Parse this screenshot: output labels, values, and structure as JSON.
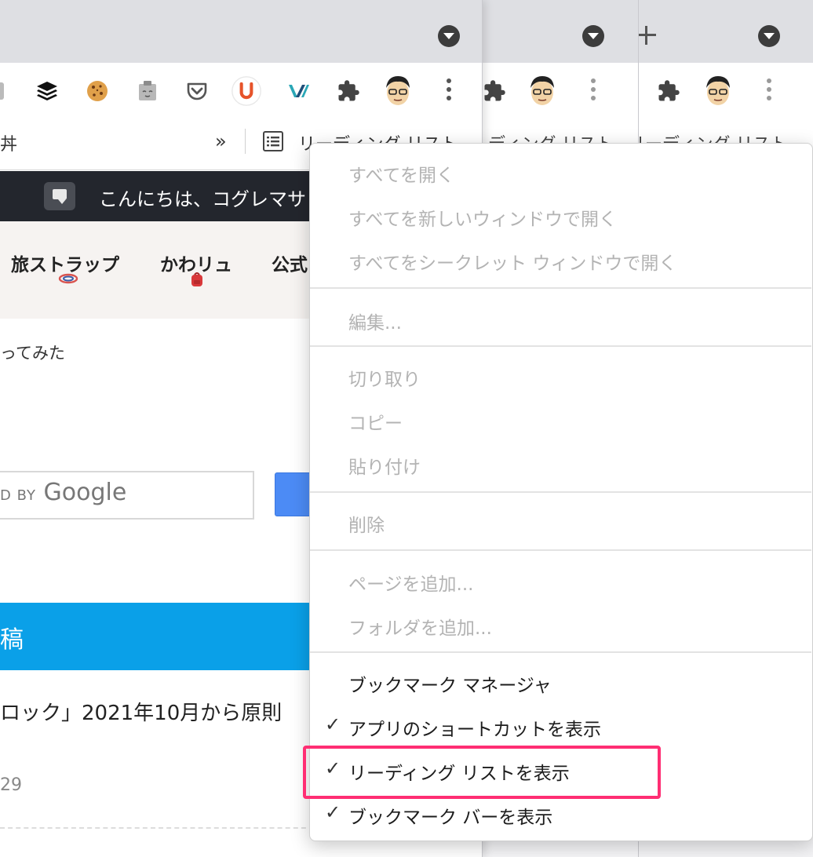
{
  "browser": {
    "bookmarks_bar": {
      "left_fragment": "丼",
      "overflow_chevron": "»",
      "reading_list_label": "リーディング リスト",
      "reading_list_label_w2": "ディング リスト",
      "reading_list_label_w3": "リーディング リスト"
    },
    "icons": [
      "menu-dropdown-icon",
      "new-tab-icon",
      "buffer-stack-icon",
      "cookie-icon",
      "clipboard-extension-icon",
      "pocket-icon",
      "u-extension-icon",
      "v-extension-icon",
      "puzzle-extensions-icon",
      "profile-avatar-icon",
      "kebab-menu-icon",
      "reading-list-icon"
    ]
  },
  "page": {
    "greeting": "こんにちは、コグレマサト",
    "nav": {
      "item1": "旅ストラップ",
      "item2": "かわリュ",
      "item3": "公式"
    },
    "snippet": "ってみた",
    "search": {
      "placeholder_by": "D BY",
      "placeholder_brand": "Google"
    },
    "blue_bar_text": "稿",
    "headline": "ロック」2021年10月から原則",
    "date": "29"
  },
  "context_menu": {
    "items": [
      {
        "label": "すべてを開く",
        "enabled": false,
        "checked": false
      },
      {
        "label": "すべてを新しいウィンドウで開く",
        "enabled": false,
        "checked": false
      },
      {
        "label": "すべてをシークレット ウィンドウで開く",
        "enabled": false,
        "checked": false
      },
      {
        "label": "編集...",
        "enabled": false,
        "checked": false
      },
      {
        "label": "切り取り",
        "enabled": false,
        "checked": false
      },
      {
        "label": "コピー",
        "enabled": false,
        "checked": false
      },
      {
        "label": "貼り付け",
        "enabled": false,
        "checked": false
      },
      {
        "label": "削除",
        "enabled": false,
        "checked": false
      },
      {
        "label": "ページを追加...",
        "enabled": false,
        "checked": false
      },
      {
        "label": "フォルダを追加...",
        "enabled": false,
        "checked": false
      },
      {
        "label": "ブックマーク マネージャ",
        "enabled": true,
        "checked": false
      },
      {
        "label": "アプリのショートカットを表示",
        "enabled": true,
        "checked": true
      },
      {
        "label": "リーディング リストを表示",
        "enabled": true,
        "checked": true
      },
      {
        "label": "ブックマーク バーを表示",
        "enabled": true,
        "checked": true
      }
    ],
    "check_glyph": "✓"
  },
  "annotation": {
    "highlight_color": "#ff2e73"
  }
}
